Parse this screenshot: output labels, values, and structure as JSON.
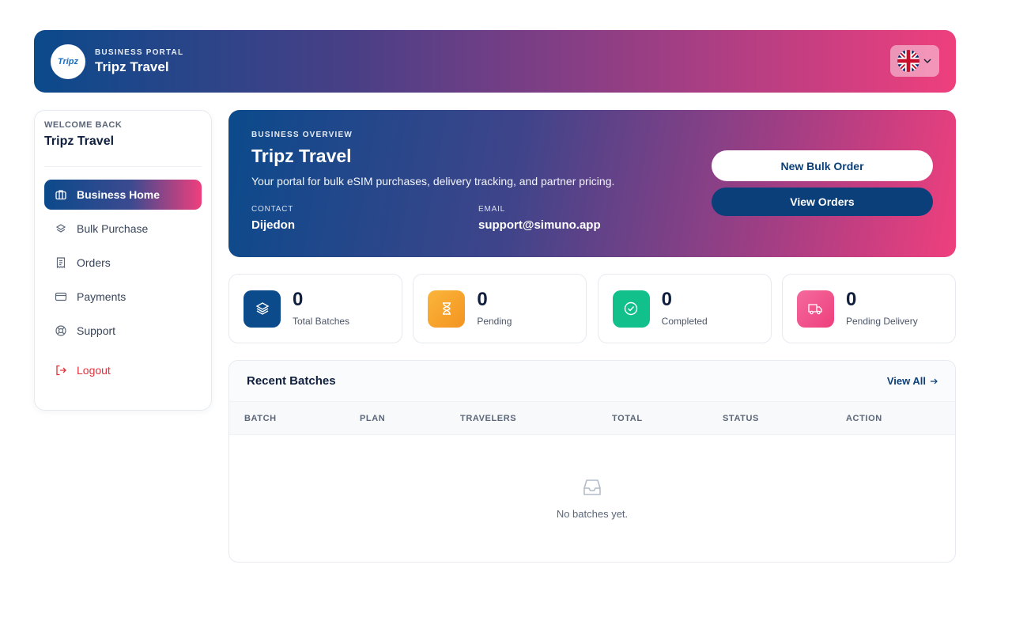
{
  "header": {
    "logo_text": "Tripz",
    "eyebrow": "BUSINESS PORTAL",
    "company": "Tripz Travel",
    "language_icon": "uk-flag-icon"
  },
  "sidebar": {
    "welcome": "WELCOME BACK",
    "user": "Tripz Travel",
    "items": [
      {
        "label": "Business Home",
        "icon": "briefcase-icon",
        "active": true
      },
      {
        "label": "Bulk Purchase",
        "icon": "layers-icon"
      },
      {
        "label": "Orders",
        "icon": "receipt-icon"
      },
      {
        "label": "Payments",
        "icon": "credit-card-icon"
      },
      {
        "label": "Support",
        "icon": "lifebuoy-icon"
      }
    ],
    "logout": "Logout"
  },
  "hero": {
    "eyebrow": "BUSINESS OVERVIEW",
    "title": "Tripz Travel",
    "description": "Your portal for bulk eSIM purchases, delivery tracking, and partner pricing.",
    "contact_label": "CONTACT",
    "contact_value": "Dijedon",
    "email_label": "EMAIL",
    "email_value": "support@simuno.app",
    "new_bulk_order": "New Bulk Order",
    "view_orders": "View Orders"
  },
  "stats": [
    {
      "value": "0",
      "label": "Total Batches",
      "icon": "layers-icon",
      "color": "#0b4a8b"
    },
    {
      "value": "0",
      "label": "Pending",
      "icon": "hourglass-icon",
      "color": "#f7a12b"
    },
    {
      "value": "0",
      "label": "Completed",
      "icon": "check-circle-icon",
      "color": "#11c08a"
    },
    {
      "value": "0",
      "label": "Pending Delivery",
      "icon": "truck-icon",
      "color": "#f0508a"
    }
  ],
  "recent": {
    "title": "Recent Batches",
    "view_all": "View All",
    "columns": [
      "BATCH",
      "PLAN",
      "TRAVELERS",
      "TOTAL",
      "STATUS",
      "ACTION"
    ],
    "empty": "No batches yet."
  }
}
